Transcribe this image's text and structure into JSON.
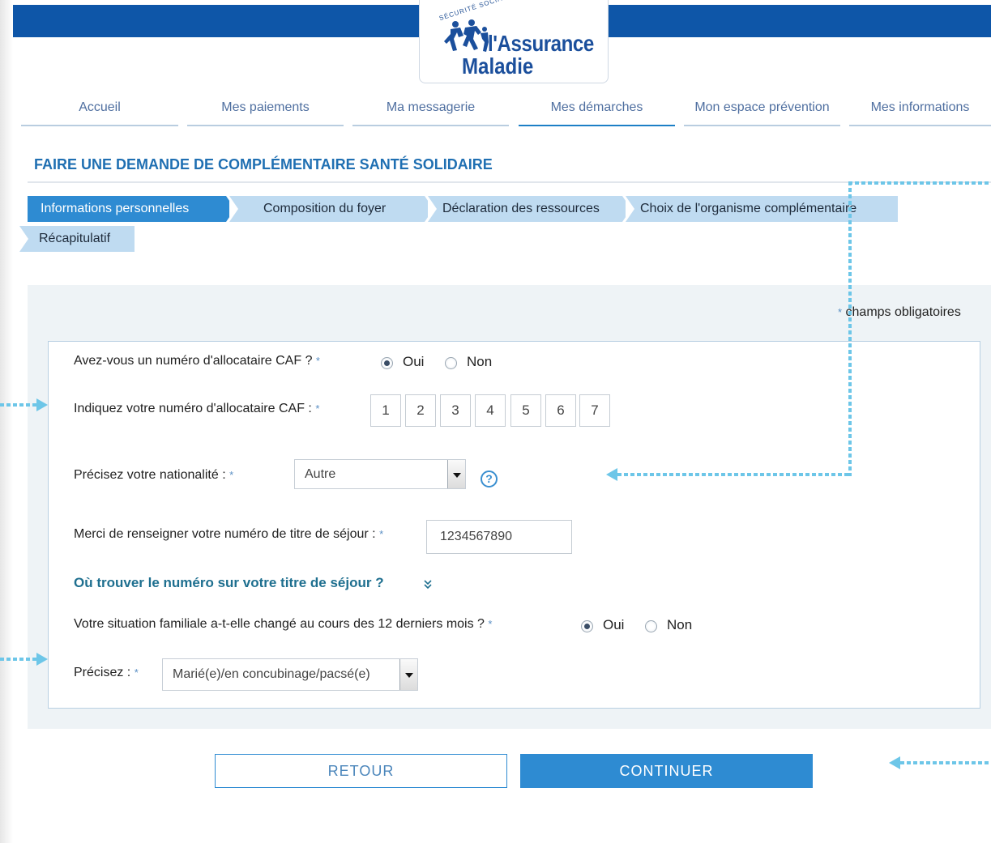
{
  "brand": {
    "arc_text": "SÉCURITÉ SOCIALE",
    "name_line1": "l'Assurance",
    "name_line2": "Maladie",
    "primary_color": "#0e56a8",
    "accent_color": "#2e8bd2"
  },
  "nav": {
    "items": [
      {
        "label": "Accueil",
        "active": false
      },
      {
        "label": "Mes paiements",
        "active": false
      },
      {
        "label": "Ma messagerie",
        "active": false
      },
      {
        "label": "Mes démarches",
        "active": true
      },
      {
        "label": "Mon espace prévention",
        "active": false
      },
      {
        "label": "Mes informations",
        "active": false
      }
    ]
  },
  "page": {
    "title": "FAIRE UNE DEMANDE DE COMPLÉMENTAIRE SANTÉ SOLIDAIRE"
  },
  "steps": [
    {
      "label": "Informations personnelles",
      "active": true
    },
    {
      "label": "Composition du foyer",
      "active": false
    },
    {
      "label": "Déclaration des ressources",
      "active": false
    },
    {
      "label": "Choix de l'organisme complémentaire",
      "active": false
    },
    {
      "label": "Récapitulatif",
      "active": false
    }
  ],
  "form": {
    "required_star": "*",
    "required_note": "champs obligatoires",
    "caf_question": "Avez-vous un numéro d'allocataire CAF ?",
    "caf_yes": "Oui",
    "caf_no": "Non",
    "caf_selected": "Oui",
    "caf_number_label": "Indiquez votre numéro d'allocataire CAF :",
    "caf_digits": [
      "1",
      "2",
      "3",
      "4",
      "5",
      "6",
      "7"
    ],
    "nationality_label": "Précisez votre nationalité :",
    "nationality_value": "Autre",
    "help_glyph": "?",
    "permit_label": "Merci de renseigner votre numéro de titre de séjour :",
    "permit_value": "1234567890",
    "permit_link": "Où trouver le numéro sur votre titre de séjour ?",
    "family_question": "Votre situation familiale a-t-elle changé au cours des 12 derniers mois ?",
    "family_yes": "Oui",
    "family_no": "Non",
    "family_selected": "Oui",
    "family_detail_label": "Précisez :",
    "family_detail_value": "Marié(e)/en concubinage/pacsé(e)"
  },
  "actions": {
    "back": "RETOUR",
    "continue": "CONTINUER"
  },
  "icons": {
    "help": "question-circle-icon",
    "chevron": "double-chevron-down-icon",
    "select": "dropdown-arrow-icon"
  }
}
